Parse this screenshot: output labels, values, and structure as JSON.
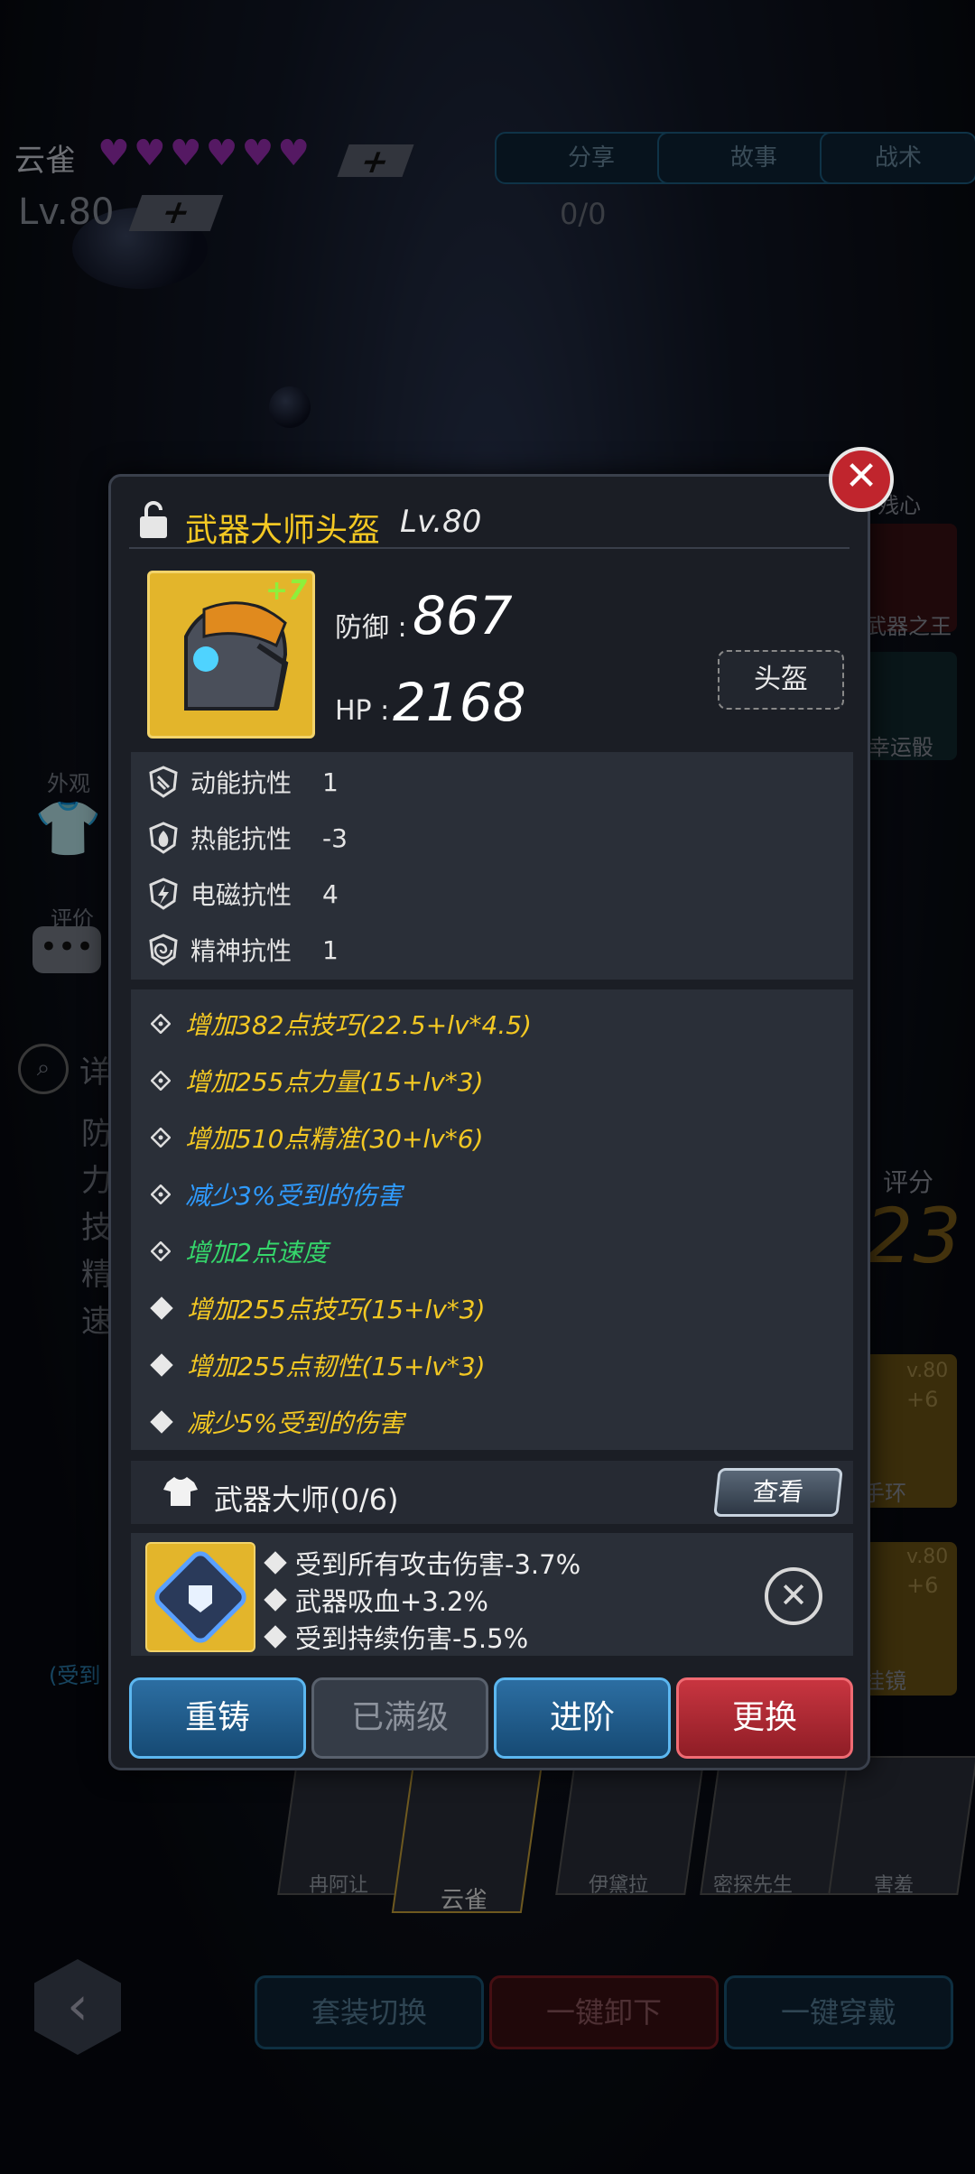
{
  "colors": {
    "accent_gold": "#f3c823",
    "accent_blue": "#2f9bff",
    "accent_green": "#35d66b",
    "danger": "#c0252d"
  },
  "hud": {
    "name": "云雀",
    "level": "Lv.80",
    "hearts": 6,
    "ratio": "0/0",
    "buttons": [
      "分享",
      "故事",
      "战术"
    ]
  },
  "left_panel": {
    "appearance": "外观",
    "rating": "评价",
    "detail": "详",
    "stats": [
      "防",
      "力",
      "技",
      "精",
      "速"
    ],
    "damage_text": "(受到"
  },
  "right_panel": {
    "skills": [
      "残心",
      "武器之王",
      "幸运骰"
    ],
    "score_label": "评分",
    "score_value": "23",
    "items": [
      {
        "level": "v.80",
        "plus": "+6",
        "name": "手环"
      },
      {
        "level": "v.80",
        "plus": "+6",
        "name": "挂镜"
      }
    ]
  },
  "roster": [
    "冉阿让",
    "云雀",
    "伊黛拉",
    "密探先生",
    "害羞"
  ],
  "bottom_actions": [
    "套装切换",
    "一键卸下",
    "一键穿戴"
  ],
  "modal": {
    "title": "武器大师头盔",
    "level": "Lv.80",
    "plus": "+7",
    "defense_label": "防御 :",
    "defense_value": "867",
    "hp_label": "HP :",
    "hp_value": "2168",
    "slot": "头盔",
    "resists": [
      {
        "name": "动能抗性",
        "value": "1",
        "icon": "kinetic-icon"
      },
      {
        "name": "热能抗性",
        "value": "-3",
        "icon": "fire-icon"
      },
      {
        "name": "电磁抗性",
        "value": "4",
        "icon": "em-icon"
      },
      {
        "name": "精神抗性",
        "value": "1",
        "icon": "psi-icon"
      }
    ],
    "attrs": [
      {
        "text": "增加382点技巧(22.5+lv*4.5)",
        "color": "#f3c823",
        "marker": "outline"
      },
      {
        "text": "增加255点力量(15+lv*3)",
        "color": "#f3c823",
        "marker": "outline"
      },
      {
        "text": "增加510点精准(30+lv*6)",
        "color": "#f3c823",
        "marker": "outline"
      },
      {
        "text": "减少3%受到的伤害",
        "color": "#2f9bff",
        "marker": "outline"
      },
      {
        "text": "增加2点速度",
        "color": "#35d66b",
        "marker": "outline"
      },
      {
        "text": "增加255点技巧(15+lv*3)",
        "color": "#f3c823",
        "marker": "solid"
      },
      {
        "text": "增加255点韧性(15+lv*3)",
        "color": "#f3c823",
        "marker": "solid"
      },
      {
        "text": "减少5%受到的伤害",
        "color": "#f3c823",
        "marker": "solid"
      }
    ],
    "set_name": "武器大师(0/6)",
    "view_label": "查看",
    "gem_effects": [
      "受到所有攻击伤害-3.7%",
      "武器吸血+3.2%",
      "受到持续伤害-5.5%"
    ],
    "actions": {
      "recast": "重铸",
      "maxed": "已满级",
      "advance": "进阶",
      "replace": "更换"
    }
  }
}
